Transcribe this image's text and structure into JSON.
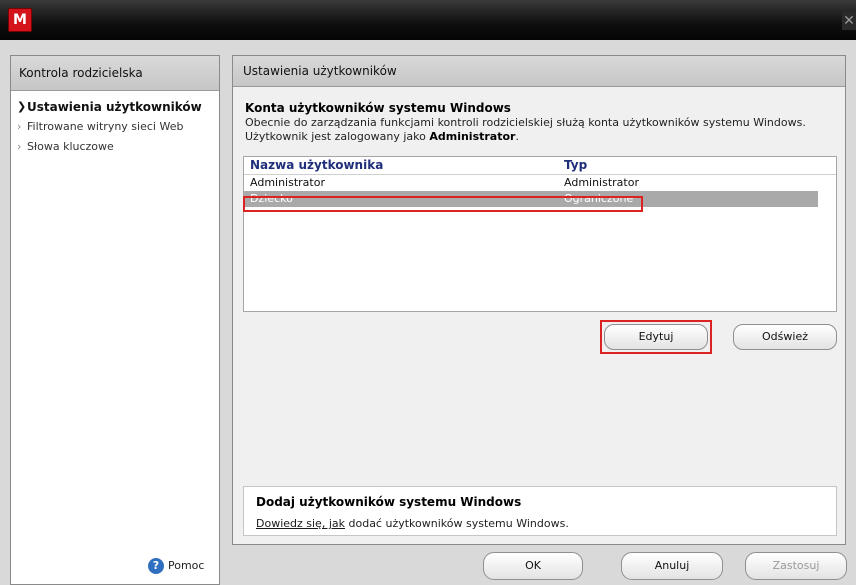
{
  "window": {
    "logo_letter": "M",
    "close_glyph": "✕"
  },
  "sidebar": {
    "title": "Kontrola rodzicielska",
    "items": [
      {
        "label": "Ustawienia użytkowników",
        "active": true
      },
      {
        "label": "Filtrowane witryny sieci Web",
        "active": false
      },
      {
        "label": "Słowa kluczowe",
        "active": false
      }
    ],
    "help_label": "Pomoc"
  },
  "main": {
    "header": "Ustawienia użytkowników",
    "section_title": "Konta użytkowników systemu Windows",
    "desc_line1": "Obecnie do zarządzania funkcjami kontroli rodzicielskiej służą konta użytkowników systemu Windows.",
    "desc_line2_prefix": "Użytkownik jest zalogowany jako ",
    "desc_line2_user": "Administrator",
    "desc_line2_suffix": ".",
    "table": {
      "columns": [
        "Nazwa użytkownika",
        "Typ"
      ],
      "rows": [
        {
          "name": "Administrator",
          "type": "Administrator"
        },
        {
          "name": "Dziecko",
          "type": "Ograniczone"
        }
      ]
    },
    "buttons": {
      "edit": "Edytuj",
      "refresh": "Odśwież"
    },
    "add_section": {
      "title": "Dodaj użytkowników systemu Windows",
      "link": "Dowiedz się, jak",
      "text": " dodać użytkowników systemu Windows."
    }
  },
  "footer": {
    "ok": "OK",
    "cancel": "Anuluj",
    "apply": "Zastosuj"
  },
  "colors": {
    "selection": "#a9a9a9",
    "highlight_box": "#dd2222",
    "header_text": "#1f2f7a"
  }
}
